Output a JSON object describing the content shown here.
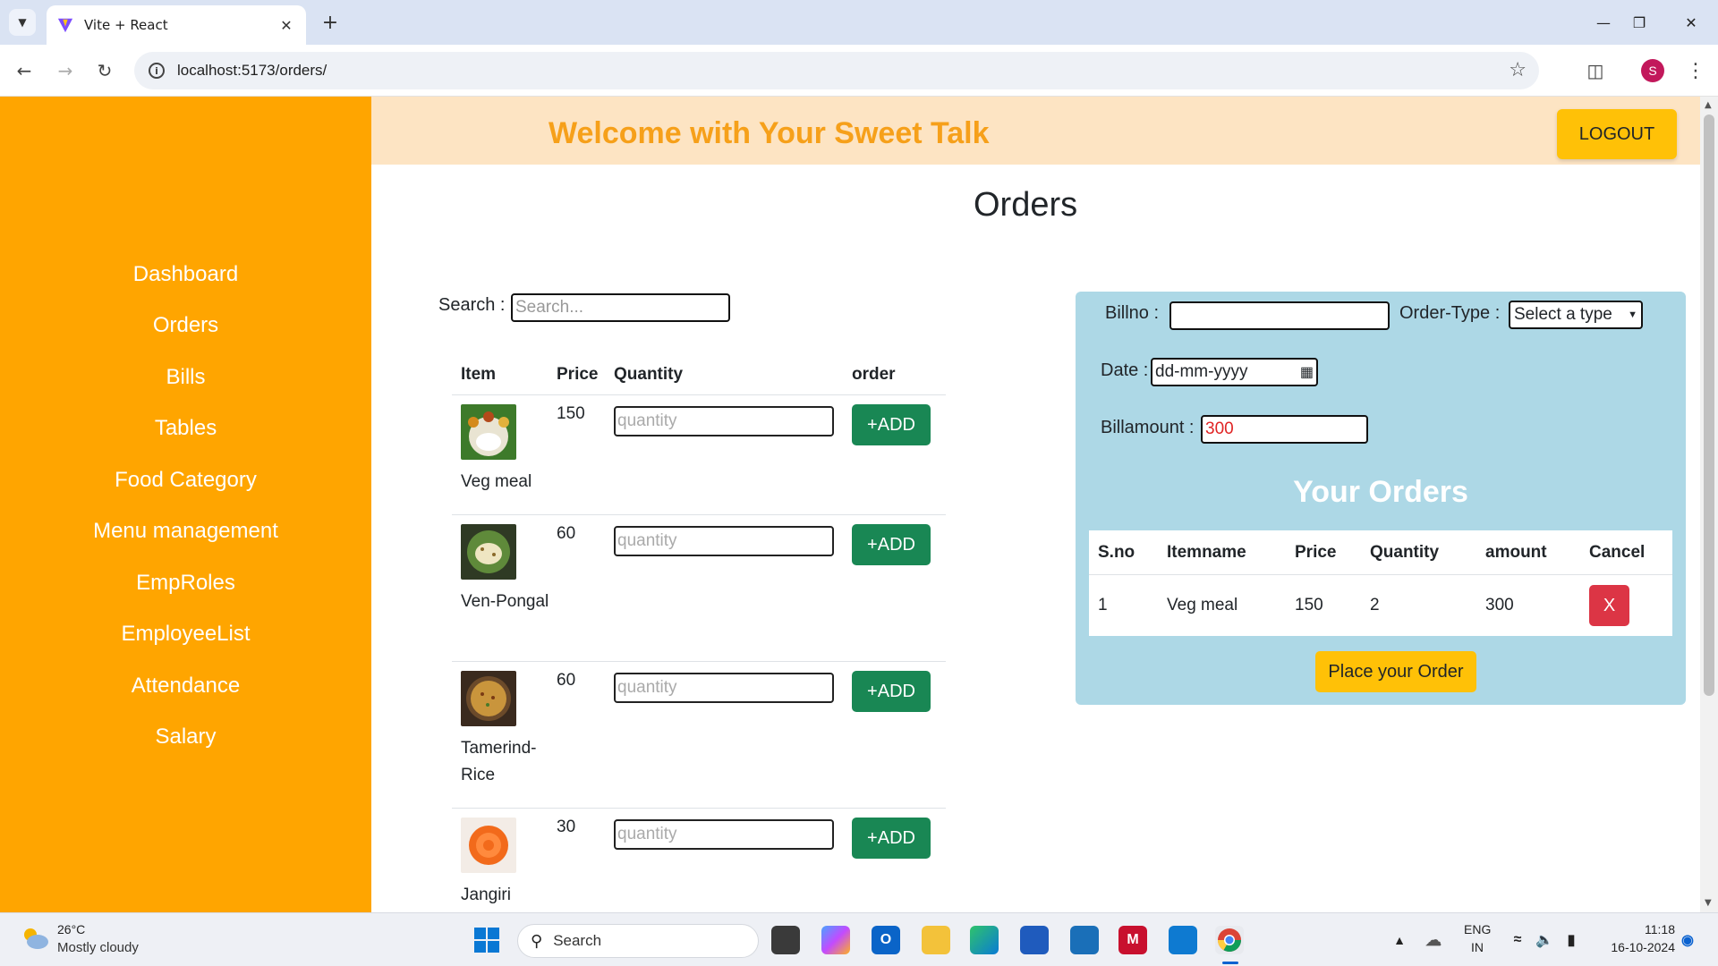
{
  "browser": {
    "tab_title": "Vite + React",
    "url": "localhost:5173/orders/",
    "profile_initial": "S"
  },
  "app": {
    "welcome": "Welcome with Your Sweet Talk",
    "logout_label": "LOGOUT",
    "page_title": "Orders",
    "colors": {
      "sidebar": "#ffa500",
      "banner": "#fde4c3",
      "welcome_text": "#f6a01a",
      "panel": "#add8e6",
      "add_button": "#198754",
      "cancel_button": "#dc3545",
      "accent_button": "#ffc107"
    }
  },
  "sidebar": {
    "items": [
      {
        "label": "Dashboard"
      },
      {
        "label": "Orders"
      },
      {
        "label": "Bills"
      },
      {
        "label": "Tables"
      },
      {
        "label": "Food Category"
      },
      {
        "label": "Menu management"
      },
      {
        "label": "EmpRoles"
      },
      {
        "label": "EmployeeList"
      },
      {
        "label": "Attendance"
      },
      {
        "label": "Salary"
      }
    ]
  },
  "search": {
    "label": "Search :",
    "placeholder": "Search..."
  },
  "menu_table": {
    "headers": {
      "item": "Item",
      "price": "Price",
      "quantity": "Quantity",
      "order": "order"
    },
    "qty_placeholder": "quantity",
    "add_label": "+ADD",
    "rows": [
      {
        "name": "Veg meal",
        "price": "150",
        "image": "veg-meal-thumbnail"
      },
      {
        "name": "Ven-Pongal",
        "price": "60",
        "image": "pongal-thumbnail"
      },
      {
        "name": "Tamerind-Rice",
        "price": "60",
        "image": "tamarind-rice-thumbnail"
      },
      {
        "name": "Jangiri",
        "price": "30",
        "image": "jangiri-thumbnail"
      }
    ]
  },
  "order_panel": {
    "billno_label": "Billno :",
    "billno_value": "",
    "order_type_label": "Order-Type :",
    "order_type_value": "Select a type",
    "date_label": "Date :",
    "date_placeholder": "dd-mm-yyyy",
    "billamount_label": "Billamount :",
    "billamount_value": "300",
    "your_orders_title": "Your Orders",
    "table_headers": {
      "sno": "S.no",
      "itemname": "Itemname",
      "price": "Price",
      "quantity": "Quantity",
      "amount": "amount",
      "cancel": "Cancel"
    },
    "rows": [
      {
        "sno": "1",
        "itemname": "Veg meal",
        "price": "150",
        "quantity": "2",
        "amount": "300",
        "cancel_label": "X"
      }
    ],
    "place_order_label": "Place your Order"
  },
  "taskbar": {
    "weather_temp": "26°C",
    "weather_desc": "Mostly cloudy",
    "search_label": "Search",
    "lang_top": "ENG",
    "lang_bottom": "IN",
    "time": "11:18",
    "date": "16-10-2024"
  }
}
